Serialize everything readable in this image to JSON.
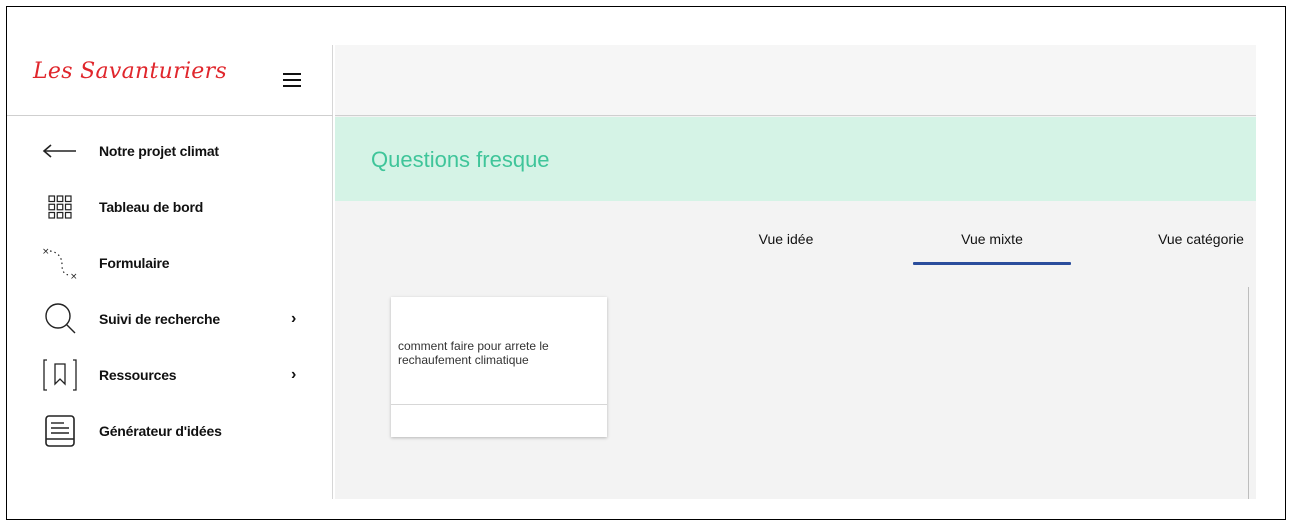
{
  "brand": {
    "logo_text": "Les Savanturiers",
    "color": "#e0262c"
  },
  "sidebar": {
    "items": [
      {
        "label": "Notre projet climat",
        "icon": "arrow-left-icon",
        "has_chevron": false
      },
      {
        "label": "Tableau de bord",
        "icon": "grid-icon",
        "has_chevron": false
      },
      {
        "label": "Formulaire",
        "icon": "path-icon",
        "has_chevron": false
      },
      {
        "label": "Suivi de recherche",
        "icon": "search-icon",
        "has_chevron": true
      },
      {
        "label": "Ressources",
        "icon": "bookmark-icon",
        "has_chevron": true
      },
      {
        "label": "Générateur d'idées",
        "icon": "document-icon",
        "has_chevron": false
      }
    ],
    "chevron": "›"
  },
  "main": {
    "banner_title": "Questions fresque",
    "banner_color": "#d5f3e6",
    "title_color": "#3fc59a",
    "tabs": [
      {
        "label": "Vue idée",
        "active": false
      },
      {
        "label": "Vue mixte",
        "active": true
      },
      {
        "label": "Vue catégorie",
        "active": false
      }
    ],
    "active_tab_color": "#2a4d9c",
    "cards": [
      {
        "text": "comment faire pour arrete le rechaufement climatique"
      }
    ]
  }
}
